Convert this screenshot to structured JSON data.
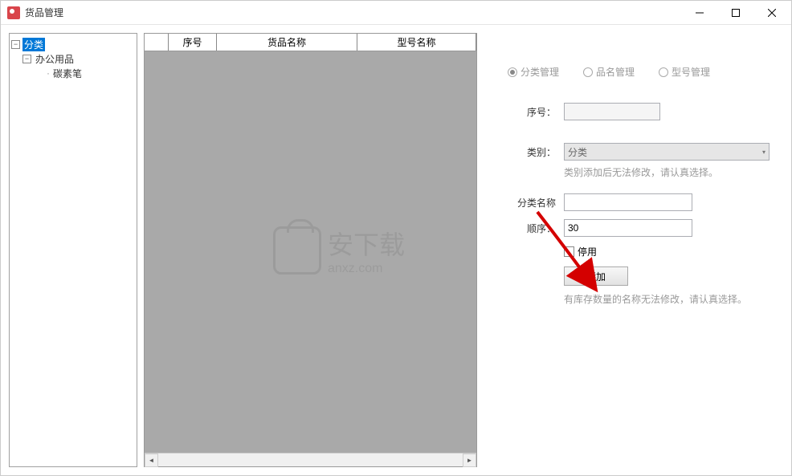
{
  "window": {
    "title": "货品管理"
  },
  "tree": {
    "root": "分类",
    "child1": "办公用品",
    "child2": "碳素笔"
  },
  "table": {
    "col1": "",
    "col2": "序号",
    "col3": "货品名称",
    "col4": "型号名称"
  },
  "form": {
    "radio1": "分类管理",
    "radio2": "品名管理",
    "radio3": "型号管理",
    "seq_label": "序号：",
    "seq_value": "",
    "category_label": "类别：",
    "category_value": "分类",
    "category_hint": "类别添加后无法修改，请认真选择。",
    "name_label": "分类名称",
    "name_value": "",
    "order_label": "顺序：",
    "order_value": "30",
    "enable_label": "停用",
    "add_btn": "添加",
    "bottom_hint": "有库存数量的名称无法修改，请认真选择。"
  },
  "watermark": {
    "text": "安下载",
    "sub": "anxz.com"
  }
}
